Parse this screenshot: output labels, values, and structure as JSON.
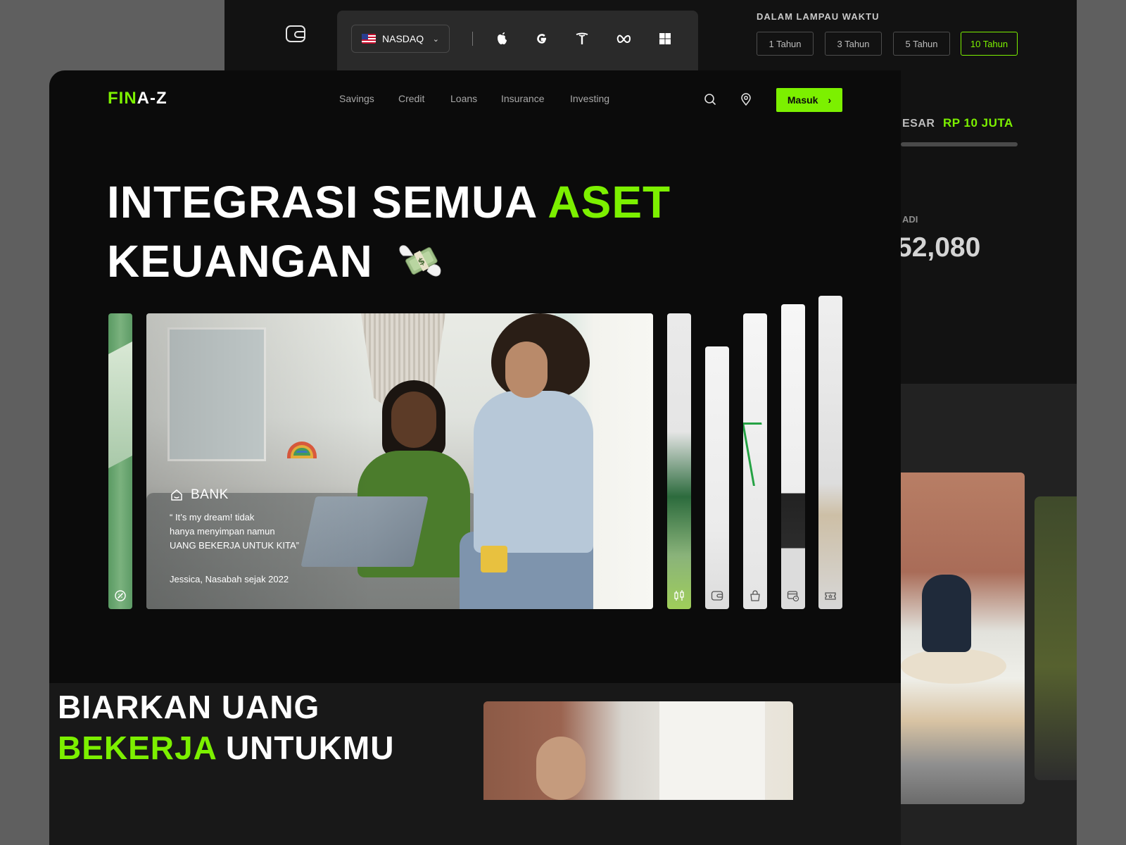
{
  "back_mockup": {
    "exchange": {
      "label": "NASDAQ"
    },
    "tickers": [
      "apple-icon",
      "google-icon",
      "tesla-icon",
      "meta-icon",
      "microsoft-icon"
    ],
    "time_label": "DALAM LAMPAU WAKTU",
    "periods": [
      {
        "label": "1 Tahun",
        "active": false
      },
      {
        "label": "3 Tahun",
        "active": false
      },
      {
        "label": "5 Tahun",
        "active": false
      },
      {
        "label": "10 Tahun",
        "active": true
      }
    ],
    "row_label_fragment": "ESAR",
    "row_value": "RP 10 JUTA",
    "small_label_fragment": "ADI",
    "big_value_fragment": "52,080"
  },
  "header": {
    "logo_accent": "FIN",
    "logo_rest": "A-Z",
    "nav": [
      "Savings",
      "Credit",
      "Loans",
      "Insurance",
      "Investing"
    ],
    "cta_label": "Masuk"
  },
  "hero": {
    "line1_a": "INTEGRASI SEMUA",
    "line1_b": "ASET",
    "line2": "KEUANGAN",
    "emoji": "money-with-wings"
  },
  "feature_card": {
    "category": "BANK",
    "quote_lines": [
      "“ It’s my dream! tidak",
      "hanya menyimpan namun",
      "UANG BEKERJA UNTUK KITA”"
    ],
    "author": "Jessica, Nasabah sejak 2022"
  },
  "side_strip_icons": [
    "coin-badge-icon",
    "candlestick-icon",
    "wallet-icon",
    "shopping-bag-icon",
    "card-clock-icon",
    "ticket-icon"
  ],
  "section2": {
    "line1": "BIARKAN UANG",
    "line2_a": "BEKERJA",
    "line2_b": "UNTUKMU"
  },
  "colors": {
    "accent": "#7cf000",
    "background": "#0b0b0b",
    "surface": "#181818"
  }
}
